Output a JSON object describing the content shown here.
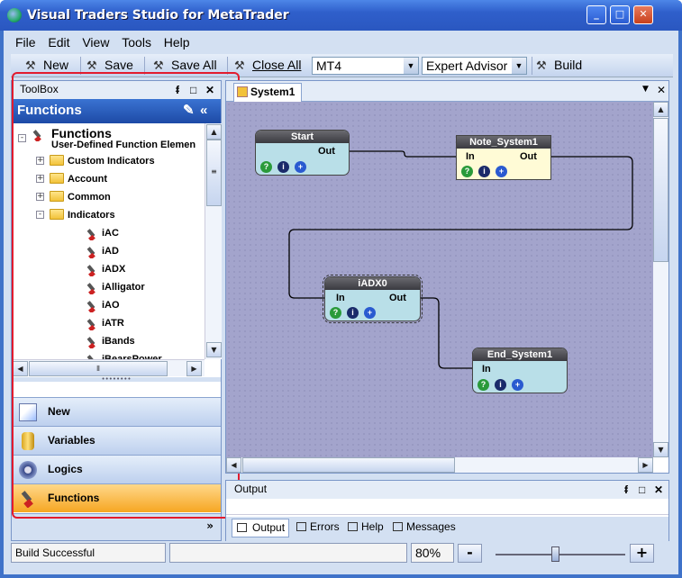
{
  "window": {
    "title": "Visual Traders Studio for MetaTrader"
  },
  "menu": [
    "File",
    "Edit",
    "View",
    "Tools",
    "Help"
  ],
  "toolbar": {
    "new": "New",
    "save": "Save",
    "save_all": "Save All",
    "close_all": "Close All",
    "platform": "MT4",
    "type": "Expert Advisor",
    "build": "Build"
  },
  "toolbox": {
    "title": "ToolBox",
    "header": "Functions"
  },
  "tree": {
    "root": "Functions",
    "root_sub": "User-Defined Function Elemen",
    "folders": [
      "Custom Indicators",
      "Account",
      "Common",
      "Indicators"
    ],
    "items": [
      "iAC",
      "iAD",
      "iADX",
      "iAlligator",
      "iAO",
      "iATR",
      "iBands",
      "iBearsPower"
    ]
  },
  "nav": [
    "New",
    "Variables",
    "Logics",
    "Functions"
  ],
  "document": {
    "tab": "System1"
  },
  "blocks": {
    "start": {
      "title": "Start",
      "out": "Out"
    },
    "note": {
      "title": "Note_System1",
      "in": "In",
      "out": "Out"
    },
    "iadx": {
      "title": "iADX0",
      "in": "In",
      "out": "Out"
    },
    "end": {
      "title": "End_System1",
      "in": "In"
    }
  },
  "output": {
    "title": "Output",
    "tabs": [
      "Output",
      "Errors",
      "Help",
      "Messages"
    ]
  },
  "status": {
    "message": "Build Successful",
    "zoom": "80%",
    "zoom_minus": "-",
    "zoom_plus": "+"
  },
  "colors": {
    "titlebar": "#2f5fcb",
    "canvas": "#a3a4cc",
    "active_nav": "#f6a622",
    "highlight": "#e21b2e"
  }
}
